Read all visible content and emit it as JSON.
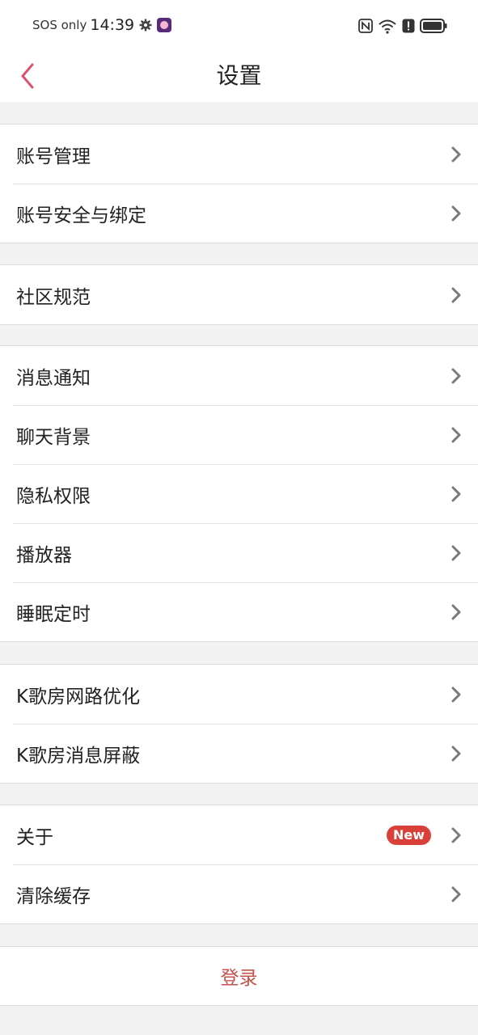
{
  "status_bar": {
    "carrier": "SOS only",
    "time": "14:39",
    "icons": [
      "gear-icon",
      "app-notification-icon",
      "nfc-icon",
      "wifi-icon",
      "alert-icon",
      "battery-icon"
    ]
  },
  "header": {
    "title": "设置",
    "back_icon": "chevron-left-icon"
  },
  "colors": {
    "accent": "#d9546e",
    "badge": "#d9403a",
    "login_text": "#c2524a",
    "background": "#f2f2f2"
  },
  "groups": [
    {
      "items": [
        {
          "label": "账号管理"
        },
        {
          "label": "账号安全与绑定"
        }
      ]
    },
    {
      "items": [
        {
          "label": "社区规范"
        }
      ]
    },
    {
      "items": [
        {
          "label": "消息通知"
        },
        {
          "label": "聊天背景"
        },
        {
          "label": "隐私权限"
        },
        {
          "label": "播放器"
        },
        {
          "label": "睡眠定时"
        }
      ]
    },
    {
      "items": [
        {
          "label": "K歌房网路优化"
        },
        {
          "label": "K歌房消息屏蔽"
        }
      ]
    },
    {
      "items": [
        {
          "label": "关于",
          "badge": "New"
        },
        {
          "label": "清除缓存"
        }
      ]
    }
  ],
  "login": {
    "label": "登录"
  }
}
